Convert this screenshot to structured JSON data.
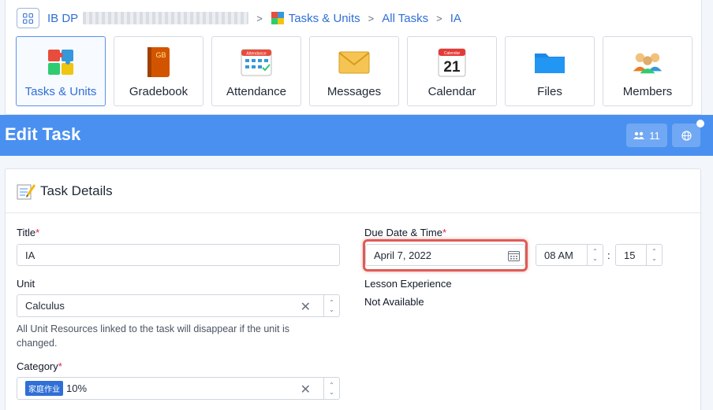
{
  "breadcrumb": {
    "course": "IB DP",
    "items": [
      "Tasks & Units",
      "All Tasks",
      "IA"
    ]
  },
  "apps": [
    {
      "label": "Tasks & Units",
      "icon": "puzzle-icon",
      "active": true
    },
    {
      "label": "Gradebook",
      "icon": "gradebook-icon"
    },
    {
      "label": "Attendance",
      "icon": "attendance-icon"
    },
    {
      "label": "Messages",
      "icon": "envelope-icon"
    },
    {
      "label": "Calendar",
      "icon": "calendar-icon"
    },
    {
      "label": "Files",
      "icon": "folder-icon"
    },
    {
      "label": "Members",
      "icon": "people-icon"
    }
  ],
  "icon_text": {
    "gradebook": "GB",
    "attendance": "Attendance",
    "calendar_day": "21",
    "calendar_header": "Calendar"
  },
  "edit": {
    "title": "Edit Task",
    "members_count": "11"
  },
  "task": {
    "section_title": "Task Details",
    "title_label": "Title",
    "title_value": "IA",
    "unit_label": "Unit",
    "unit_value": "Calculus",
    "unit_help": "All Unit Resources linked to the task will disappear if the unit is changed.",
    "category_label": "Category",
    "category_tag": "家庭作业",
    "category_value": "10%",
    "due_label": "Due Date & Time",
    "due_date": "April 7, 2022",
    "due_hour": "08 AM",
    "due_sep": ":",
    "due_minute": "15",
    "lesson_label": "Lesson Experience",
    "lesson_value": "Not Available"
  },
  "colors": {
    "accent": "#4a90f0",
    "link": "#2f6fd6",
    "required": "#e11d48",
    "highlight": "#e05a55"
  }
}
